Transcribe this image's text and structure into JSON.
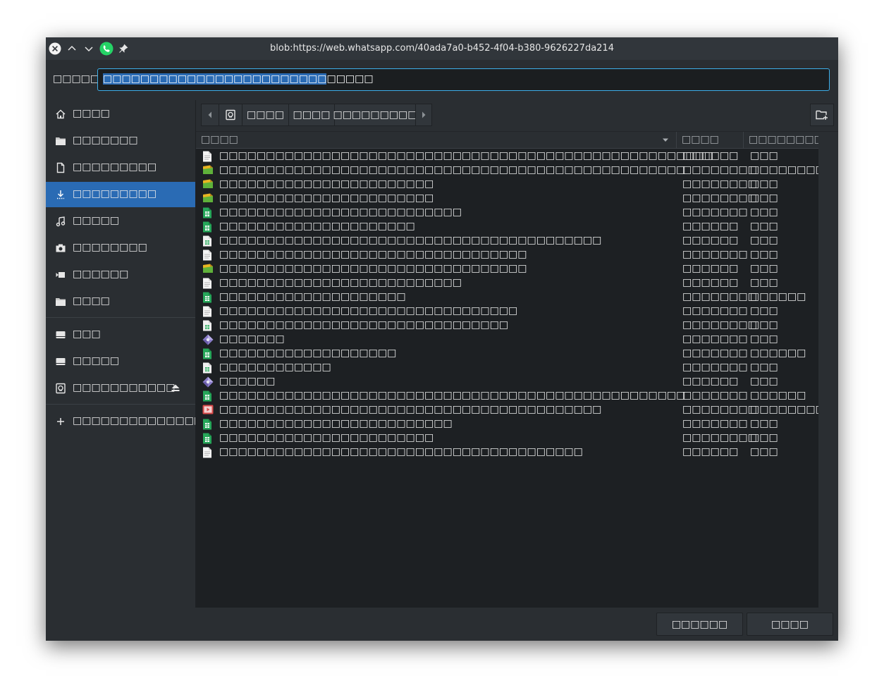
{
  "titlebar": {
    "title": "blob:https://web.whatsapp.com/40ada7a0-b452-4f04-b380-9626227da214"
  },
  "name_field": {
    "label": "□□□□□",
    "value_selected": "□□□□□□□□□□□□□□□□□□□□□□□□",
    "value_rest": "□□□□□"
  },
  "sidebar": {
    "items": [
      {
        "label": "□□□□",
        "icon": "home-icon"
      },
      {
        "label": "□□□□□□□",
        "icon": "folder-icon"
      },
      {
        "label": "□□□□□□□□□",
        "icon": "document-icon"
      },
      {
        "label": "□□□□□□□□□",
        "icon": "download-icon"
      },
      {
        "label": "□□□□□",
        "icon": "music-icon"
      },
      {
        "label": "□□□□□□□□",
        "icon": "camera-icon"
      },
      {
        "label": "□□□□□□",
        "icon": "video-icon"
      },
      {
        "label": "□□□□",
        "icon": "folder-icon"
      },
      {
        "label": "□□□",
        "icon": "drive-icon"
      },
      {
        "label": "□□□□□",
        "icon": "drive-icon"
      },
      {
        "label": "□□□□□□□□□□□",
        "icon": "removable-drive-icon"
      },
      {
        "label": "□□□□□□□□□□□□□□□",
        "icon": "plus-icon"
      }
    ]
  },
  "breadcrumb": {
    "parts": [
      "□□□□",
      "□□□□",
      "□□□□□□□□□"
    ]
  },
  "columns": {
    "name": "□□□□",
    "size": "□□□□",
    "date": "□□□□□□□□"
  },
  "files": [
    {
      "name": "□□□□□□□□□□□□□□□□□□□□□□□□□□□□□□□□□□□□□□□□□□□□□□□□□□□□□",
      "size": "□□□□□□",
      "date": "□□□",
      "icon": "text-file-icon"
    },
    {
      "name": "□□□□□□□□□□□□□□□□□□□□□□□□□□□□□□□□□□□□□□□□□□□□□□□□□□",
      "size": "□□□□□□□□",
      "date": "□□□□□□□□□",
      "icon": "image-file-icon"
    },
    {
      "name": "□□□□□□□□□□□□□□□□□□□□□□□",
      "size": "□□□□□□□□",
      "date": "□□□",
      "icon": "image-file-icon"
    },
    {
      "name": "□□□□□□□□□□□□□□□□□□□□□□□",
      "size": "□□□□□□□□",
      "date": "□□□",
      "icon": "image-file-icon"
    },
    {
      "name": "□□□□□□□□□□□□□□□□□□□□□□□□□□",
      "size": "□□□□□□□",
      "date": "□□□",
      "icon": "spreadsheet-file-icon"
    },
    {
      "name": "□□□□□□□□□□□□□□□□□□□□□",
      "size": "□□□□□□",
      "date": "□□□",
      "icon": "spreadsheet-file-icon"
    },
    {
      "name": "□□□□□□□□□□□□□□□□□□□□□□□□□□□□□□□□□□□□□□□□□",
      "size": "□□□□□□",
      "date": "□□□",
      "icon": "spreadsheet-doc-icon"
    },
    {
      "name": "□□□□□□□□□□□□□□□□□□□□□□□□□□□□□□□□□",
      "size": "□□□□□□□",
      "date": "□□□",
      "icon": "text-file-icon"
    },
    {
      "name": "□□□□□□□□□□□□□□□□□□□□□□□□□□□□□□□□□",
      "size": "□□□□□□",
      "date": "□□□",
      "icon": "image-file-icon"
    },
    {
      "name": "□□□□□□□□□□□□□□□□□□□□□□□□□□",
      "size": "□□□□□□",
      "date": "□□□",
      "icon": "text-file-icon"
    },
    {
      "name": "□□□□□□□□□□□□□□□□□□□□",
      "size": "□□□□□□□□",
      "date": "□□□□□□",
      "icon": "spreadsheet-file-icon"
    },
    {
      "name": "□□□□□□□□□□□□□□□□□□□□□□□□□□□□□□□□",
      "size": "□□□□□□□",
      "date": "□□□",
      "icon": "text-file-icon"
    },
    {
      "name": "□□□□□□□□□□□□□□□□□□□□□□□□□□□□□□□",
      "size": "□□□□□□□□",
      "date": "□□□",
      "icon": "spreadsheet-doc-icon"
    },
    {
      "name": "□□□□□□□",
      "size": "□□□□□□□",
      "date": "□□□",
      "icon": "diamond-file-icon"
    },
    {
      "name": "□□□□□□□□□□□□□□□□□□□",
      "size": "□□□□□□□",
      "date": "□□□□□□",
      "icon": "spreadsheet-file-icon"
    },
    {
      "name": "□□□□□□□□□□□□",
      "size": "□□□□□□□",
      "date": "□□□",
      "icon": "spreadsheet-doc-icon"
    },
    {
      "name": "□□□□□□",
      "size": "□□□□□□",
      "date": "□□□",
      "icon": "diamond-file-icon"
    },
    {
      "name": "□□□□□□□□□□□□□□□□□□□□□□□□□□□□□□□□□□□□□□□□□□□□□□□□□□",
      "size": "□□□□□□□",
      "date": "□□□□□□",
      "icon": "spreadsheet-file-icon"
    },
    {
      "name": "□□□□□□□□□□□□□□□□□□□□□□□□□□□□□□□□□□□□□□□□□",
      "size": "□□□□□□□□",
      "date": "□□□□□□□□□",
      "icon": "video-file-icon"
    },
    {
      "name": "□□□□□□□□□□□□□□□□□□□□□□□□□",
      "size": "□□□□□□□",
      "date": "□□□",
      "icon": "spreadsheet-file-icon"
    },
    {
      "name": "□□□□□□□□□□□□□□□□□□□□□□□",
      "size": "□□□□□□□□",
      "date": "□□□",
      "icon": "spreadsheet-file-icon"
    },
    {
      "name": "□□□□□□□□□□□□□□□□□□□□□□□□□□□□□□□□□□□□□□□",
      "size": "□□□□□□",
      "date": "□□□",
      "icon": "text-file-icon"
    }
  ],
  "footer": {
    "save_label": "□□□□□□",
    "cancel_label": "□□□□"
  },
  "colors": {
    "accent": "#3daee9",
    "selection": "#2a6bb4",
    "whatsapp": "#25d366"
  }
}
